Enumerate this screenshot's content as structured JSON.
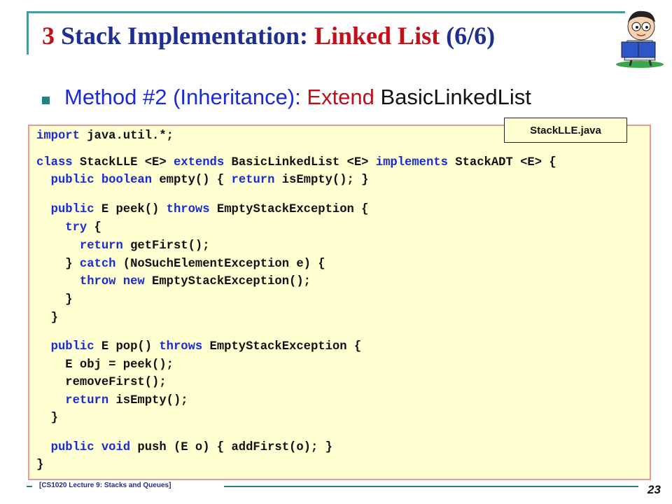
{
  "title": {
    "number": "3",
    "prefix": "Stack Implementation: ",
    "highlight": "Linked List",
    "suffix": " (6/6)"
  },
  "bullet": {
    "part1": "Method #2 (Inheritance): ",
    "part2": "Extend",
    "part3": " BasicLinkedList"
  },
  "file_tag": "StackLLE.java",
  "code": {
    "l1a": "import",
    "l1b": " java.util.*;",
    "l2a": "class",
    "l2b": " StackLLE <E> ",
    "l2c": "extends",
    "l2d": " BasicLinkedList <E> ",
    "l2e": "implements",
    "l2f": " StackADT <E> {",
    "l3a": "  public boolean",
    "l3b": " empty() { ",
    "l3c": "return",
    "l3d": " isEmpty(); }",
    "l4a": "  public",
    "l4b": " E peek() ",
    "l4c": "throws",
    "l4d": " EmptyStackException {",
    "l5a": "    try",
    "l5b": " {",
    "l6a": "      return",
    "l6b": " getFirst();",
    "l7a": "    } ",
    "l7b": "catch",
    "l7c": " (NoSuchElementException e) {",
    "l8a": "      throw new",
    "l8b": " EmptyStackException();",
    "l9": "    }",
    "l10": "  }",
    "l11a": "  public",
    "l11b": " E pop() ",
    "l11c": "throws",
    "l11d": " EmptyStackException {",
    "l12": "    E obj = peek();",
    "l13": "    removeFirst();",
    "l14a": "    return",
    "l14b": " isEmpty();",
    "l15": "  }",
    "l16a": "  public void",
    "l16b": " push (E o) { addFirst(o); }",
    "l17": "}"
  },
  "footer": {
    "course": "[CS1020 Lecture 9: Stacks and Queues]",
    "page": "23"
  }
}
